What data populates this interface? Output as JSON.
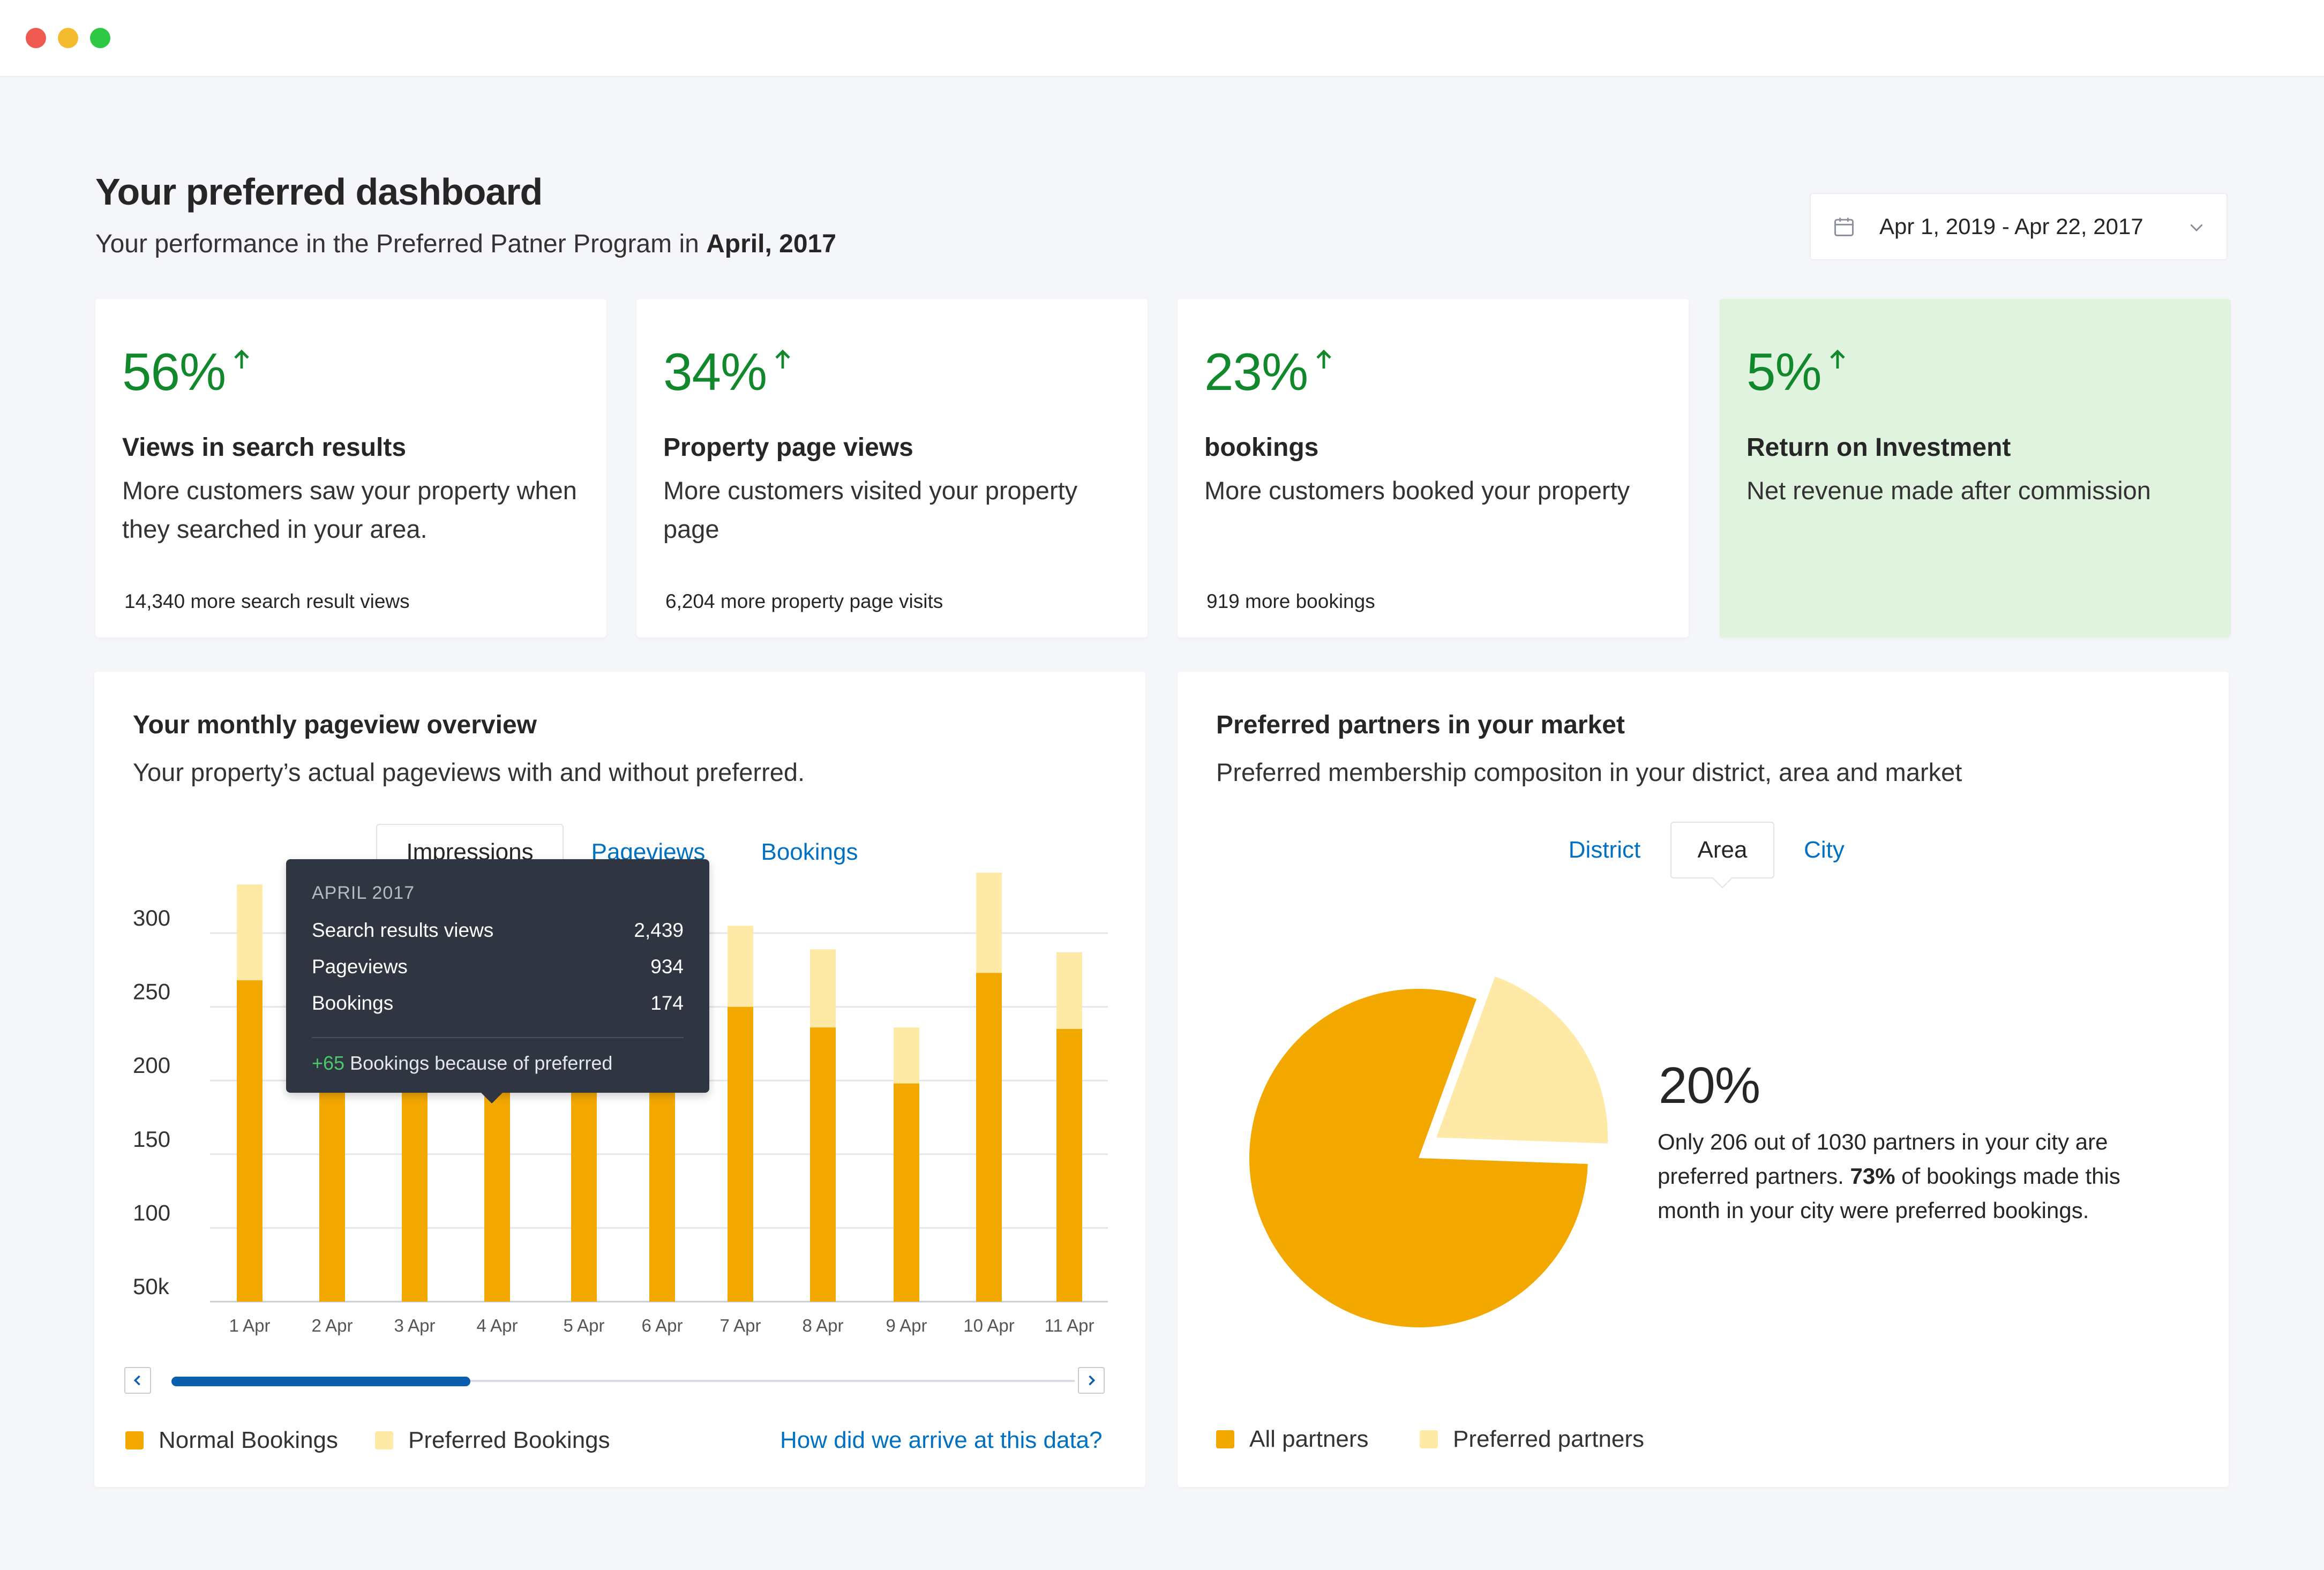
{
  "header": {
    "title": "Your preferred dashboard",
    "subtitle_prefix": "Your performance in the Preferred Patner Program in ",
    "subtitle_period": "April, 2017",
    "date_range": "Apr 1, 2019 - Apr 22, 2017"
  },
  "stats": [
    {
      "value": "56%",
      "title": "Views in search results",
      "desc": "More customers saw your property when they searched in your area.",
      "foot": "14,340 more search result views"
    },
    {
      "value": "34%",
      "title": "Property page views",
      "desc": "More customers visited your property page",
      "foot": "6,204 more property page visits"
    },
    {
      "value": "23%",
      "title": "bookings",
      "desc": "More customers booked your property",
      "foot": "919 more bookings"
    },
    {
      "value": "5%",
      "title": "Return on Investment",
      "desc": "Net revenue made after commission",
      "foot": ""
    }
  ],
  "pageview_panel": {
    "title": "Your monthly pageview overview",
    "subtitle": "Your property’s actual pageviews with and without preferred.",
    "tabs": [
      "Impressions",
      "Pageviews",
      "Bookings"
    ],
    "active_tab": "Impressions",
    "legend": [
      "Normal Bookings",
      "Preferred Bookings"
    ],
    "link": "How did we arrive at this data?",
    "tooltip": {
      "heading": "APRIL 2017",
      "rows": [
        {
          "label": "Search results views",
          "value": "2,439"
        },
        {
          "label": "Pageviews",
          "value": "934"
        },
        {
          "label": "Bookings",
          "value": "174"
        }
      ],
      "footer_plus": "+65",
      "footer_text": " Bookings because of preferred"
    }
  },
  "market_panel": {
    "title": "Preferred partners in your market",
    "subtitle": "Preferred membership compositon in your district, area and market",
    "tabs": [
      "District",
      "Area",
      "City"
    ],
    "active_tab": "Area",
    "big_value": "20%",
    "text_part1": "Only 206 out of 1030 partners in your city are preferred partners. ",
    "text_bold": "73%",
    "text_part2": " of bookings made this month in your city were preferred bookings.",
    "legend": [
      "All partners",
      "Preferred partners"
    ]
  },
  "colors": {
    "normal": "#f3a800",
    "preferred": "#feeaa6",
    "positive": "#12882c",
    "link": "#0071c2",
    "highlight_card": "#dff3df"
  },
  "chart_data": [
    {
      "type": "bar",
      "stacked": true,
      "categories": [
        "1 Apr",
        "2 Apr",
        "3 Apr",
        "4 Apr",
        "5 Apr",
        "6 Apr",
        "7 Apr",
        "8 Apr",
        "9 Apr",
        "10 Apr",
        "11 Apr"
      ],
      "series": [
        {
          "name": "Normal Bookings",
          "values": [
            218,
            172,
            186,
            148,
            182,
            185,
            200,
            186,
            148,
            223,
            185
          ]
        },
        {
          "name": "Preferred Bookings",
          "values": [
            65,
            50,
            48,
            40,
            45,
            50,
            55,
            53,
            38,
            68,
            52
          ]
        }
      ],
      "y_ticks": [
        "50k",
        "100",
        "150",
        "200",
        "250",
        "300"
      ],
      "ylim": [
        50,
        300
      ],
      "grid": true
    },
    {
      "type": "pie",
      "labels": [
        "All partners",
        "Preferred partners"
      ],
      "values": [
        80,
        20
      ]
    }
  ]
}
